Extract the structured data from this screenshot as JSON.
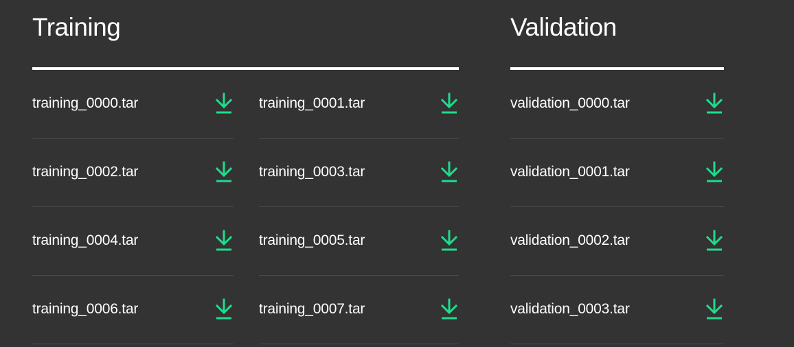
{
  "colors": {
    "background": "#333333",
    "text": "#ffffff",
    "accent": "#1fdc8c",
    "divider": "#4c4c4c"
  },
  "training": {
    "title": "Training",
    "files": [
      {
        "name": "training_0000.tar",
        "icon": "download-icon"
      },
      {
        "name": "training_0001.tar",
        "icon": "download-icon"
      },
      {
        "name": "training_0002.tar",
        "icon": "download-icon"
      },
      {
        "name": "training_0003.tar",
        "icon": "download-icon"
      },
      {
        "name": "training_0004.tar",
        "icon": "download-icon"
      },
      {
        "name": "training_0005.tar",
        "icon": "download-icon"
      },
      {
        "name": "training_0006.tar",
        "icon": "download-icon"
      },
      {
        "name": "training_0007.tar",
        "icon": "download-icon"
      }
    ]
  },
  "validation": {
    "title": "Validation",
    "files": [
      {
        "name": "validation_0000.tar",
        "icon": "download-icon"
      },
      {
        "name": "validation_0001.tar",
        "icon": "download-icon"
      },
      {
        "name": "validation_0002.tar",
        "icon": "download-icon"
      },
      {
        "name": "validation_0003.tar",
        "icon": "download-icon"
      }
    ]
  }
}
